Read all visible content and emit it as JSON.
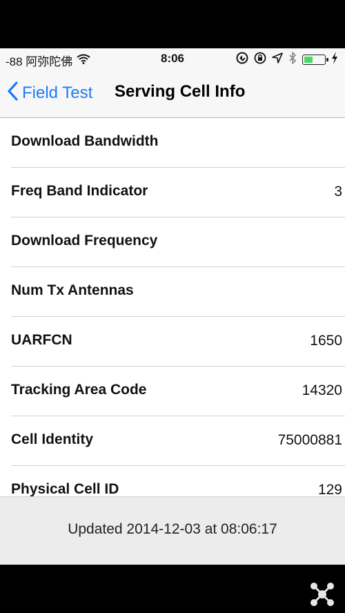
{
  "status_bar": {
    "carrier": "-88 阿弥陀佛",
    "time": "8:06",
    "icons": [
      "wifi-icon",
      "sync-icon",
      "rotation-lock-icon",
      "location-icon",
      "bluetooth-icon",
      "battery-icon",
      "charging-icon"
    ],
    "battery_level": 0.45
  },
  "nav": {
    "back_label": "Field Test",
    "title": "Serving Cell Info"
  },
  "rows": [
    {
      "label": "Download Bandwidth",
      "value": ""
    },
    {
      "label": "Freq Band Indicator",
      "value": "3"
    },
    {
      "label": "Download Frequency",
      "value": ""
    },
    {
      "label": "Num Tx Antennas",
      "value": ""
    },
    {
      "label": "UARFCN",
      "value": "1650"
    },
    {
      "label": "Tracking Area Code",
      "value": "14320"
    },
    {
      "label": "Cell Identity",
      "value": "75000881"
    },
    {
      "label": "Physical Cell ID",
      "value": "129"
    }
  ],
  "footer": {
    "updated_text": "Updated 2014-12-03 at 08:06:17"
  },
  "colors": {
    "accent": "#1a7cf5",
    "battery": "#4cd964"
  }
}
